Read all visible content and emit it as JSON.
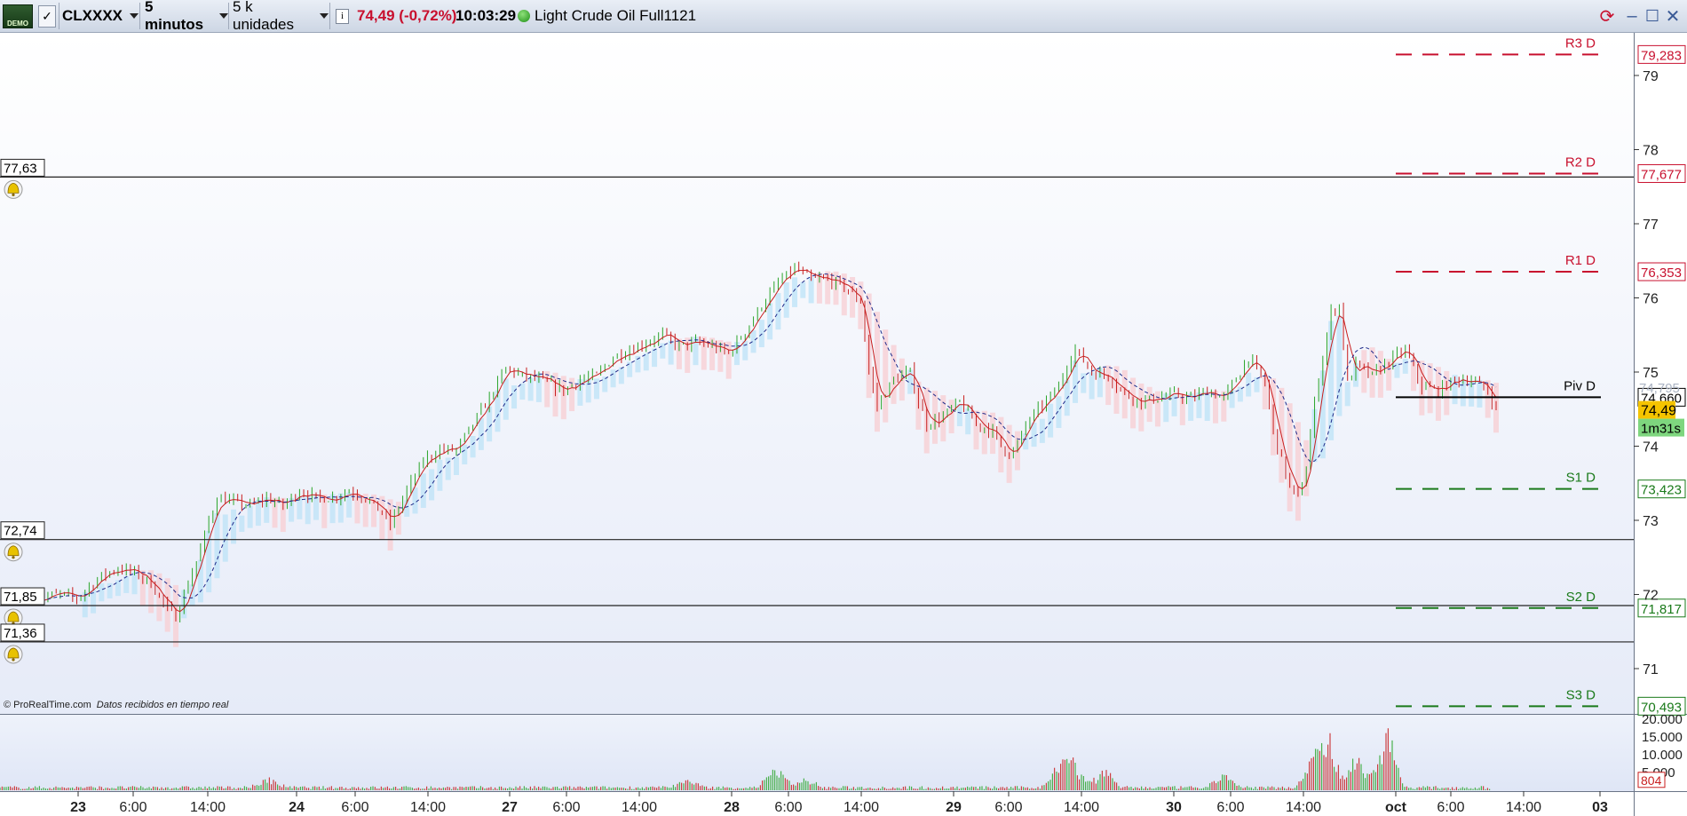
{
  "toolbar": {
    "demo_badge": "DEMO",
    "instrument": "CLXXXX",
    "timeframe": "5 minutos",
    "units": "5 k unidades",
    "price": "74,49",
    "change": "(-0,72%)",
    "time": "10:03:29",
    "instrument_name": "Light Crude Oil Full1121",
    "info_icon": "info-icon",
    "colors": {
      "price_text": "#c8102e",
      "status_dot": "#2ea32a"
    }
  },
  "window_controls": [
    "refresh-icon",
    "minimize-icon",
    "maximize-icon",
    "close-icon"
  ],
  "price_axis": {
    "ticks": [
      "79",
      "78",
      "77",
      "76",
      "75",
      "74",
      "73",
      "72",
      "71"
    ],
    "current_price": "74,49",
    "countdown": "1m31s",
    "partial_label": "74,795",
    "colors": {
      "resistance": "#c8102e",
      "support": "#1a7a1a",
      "pivot": "#000000",
      "current_bg": "#f5c400",
      "countdown_bg": "#7ed67e"
    }
  },
  "pivots": [
    {
      "label": "R3 D",
      "value": "79,283",
      "type": "resistance",
      "price": 79.283
    },
    {
      "label": "R2 D",
      "value": "77,677",
      "type": "resistance",
      "price": 77.677
    },
    {
      "label": "R1 D",
      "value": "76,353",
      "type": "resistance",
      "price": 76.353
    },
    {
      "label": "Piv D",
      "value": "74,660",
      "type": "pivot",
      "price": 74.66
    },
    {
      "label": "S1 D",
      "value": "73,423",
      "type": "support",
      "price": 73.423
    },
    {
      "label": "S2 D",
      "value": "71,817",
      "type": "support",
      "price": 71.817
    },
    {
      "label": "S3 D",
      "value": "70,493",
      "type": "support",
      "price": 70.493
    }
  ],
  "alert_lines": [
    {
      "label": "77,63",
      "price": 77.63
    },
    {
      "label": "72,74",
      "price": 72.74
    },
    {
      "label": "71,85",
      "price": 71.85
    },
    {
      "label": "71,36",
      "price": 71.36
    }
  ],
  "alert_icon": "bell-icon",
  "copyright": "© ProRealTime.com",
  "copyright_note": "Datos recibidos en tiempo real",
  "volume_axis": {
    "ticks": [
      "20.000",
      "15.000",
      "10.000",
      "5.000"
    ],
    "current": "804"
  },
  "time_axis": [
    {
      "label": "23",
      "bold": true
    },
    {
      "label": "6:00",
      "bold": false
    },
    {
      "label": "14:00",
      "bold": false
    },
    {
      "label": "24",
      "bold": true
    },
    {
      "label": "6:00",
      "bold": false
    },
    {
      "label": "14:00",
      "bold": false
    },
    {
      "label": "27",
      "bold": true
    },
    {
      "label": "6:00",
      "bold": false
    },
    {
      "label": "14:00",
      "bold": false
    },
    {
      "label": "28",
      "bold": true
    },
    {
      "label": "6:00",
      "bold": false
    },
    {
      "label": "14:00",
      "bold": false
    },
    {
      "label": "29",
      "bold": true
    },
    {
      "label": "6:00",
      "bold": false
    },
    {
      "label": "14:00",
      "bold": false
    },
    {
      "label": "30",
      "bold": true
    },
    {
      "label": "6:00",
      "bold": false
    },
    {
      "label": "14:00",
      "bold": false
    },
    {
      "label": "oct",
      "bold": true
    },
    {
      "label": "6:00",
      "bold": false
    },
    {
      "label": "14:00",
      "bold": false
    },
    {
      "label": "03",
      "bold": true
    }
  ],
  "price_path": [
    [
      0,
      71.95
    ],
    [
      3,
      72.0
    ],
    [
      5,
      71.95
    ],
    [
      8,
      72.25
    ],
    [
      10,
      72.35
    ],
    [
      12,
      72.3
    ],
    [
      14,
      72.15
    ],
    [
      16,
      71.8
    ],
    [
      17,
      71.7
    ],
    [
      18,
      72.0
    ],
    [
      20,
      72.6
    ],
    [
      21,
      73.0
    ],
    [
      22,
      73.3
    ],
    [
      24,
      73.25
    ],
    [
      26,
      73.2
    ],
    [
      28,
      73.3
    ],
    [
      30,
      73.2
    ],
    [
      32,
      73.4
    ],
    [
      34,
      73.3
    ],
    [
      36,
      73.3
    ],
    [
      38,
      73.4
    ],
    [
      40,
      73.3
    ],
    [
      42,
      73.1
    ],
    [
      43,
      72.95
    ],
    [
      45,
      73.4
    ],
    [
      47,
      73.8
    ],
    [
      49,
      73.95
    ],
    [
      51,
      73.95
    ],
    [
      53,
      74.3
    ],
    [
      55,
      74.65
    ],
    [
      57,
      75.05
    ],
    [
      59,
      74.95
    ],
    [
      61,
      74.9
    ],
    [
      63,
      74.8
    ],
    [
      64,
      74.75
    ],
    [
      66,
      74.9
    ],
    [
      68,
      74.95
    ],
    [
      70,
      75.2
    ],
    [
      72,
      75.3
    ],
    [
      74,
      75.4
    ],
    [
      76,
      75.5
    ],
    [
      78,
      75.35
    ],
    [
      80,
      75.4
    ],
    [
      82,
      75.35
    ],
    [
      84,
      75.25
    ],
    [
      86,
      75.55
    ],
    [
      88,
      75.9
    ],
    [
      90,
      76.2
    ],
    [
      92,
      76.4
    ],
    [
      94,
      76.25
    ],
    [
      96,
      76.25
    ],
    [
      98,
      76.15
    ],
    [
      100,
      75.95
    ],
    [
      101,
      75.0
    ],
    [
      102,
      74.55
    ],
    [
      104,
      74.9
    ],
    [
      106,
      75.0
    ],
    [
      107,
      74.6
    ],
    [
      108,
      74.3
    ],
    [
      110,
      74.4
    ],
    [
      112,
      74.6
    ],
    [
      114,
      74.3
    ],
    [
      116,
      74.2
    ],
    [
      117,
      74.0
    ],
    [
      118,
      73.9
    ],
    [
      119,
      74.0
    ],
    [
      120,
      74.3
    ],
    [
      122,
      74.55
    ],
    [
      124,
      74.8
    ],
    [
      125,
      75.1
    ],
    [
      126,
      75.3
    ],
    [
      128,
      75.0
    ],
    [
      130,
      74.95
    ],
    [
      132,
      74.7
    ],
    [
      134,
      74.6
    ],
    [
      136,
      74.65
    ],
    [
      138,
      74.7
    ],
    [
      140,
      74.65
    ],
    [
      142,
      74.75
    ],
    [
      144,
      74.65
    ],
    [
      146,
      75.0
    ],
    [
      147,
      75.2
    ],
    [
      149,
      74.85
    ],
    [
      150,
      74.2
    ],
    [
      151,
      73.8
    ],
    [
      152,
      73.45
    ],
    [
      153,
      73.3
    ],
    [
      154,
      73.7
    ],
    [
      155,
      74.6
    ],
    [
      156,
      75.2
    ],
    [
      157,
      75.8
    ],
    [
      158,
      75.9
    ],
    [
      159,
      74.85
    ],
    [
      160,
      75.1
    ],
    [
      162,
      74.95
    ],
    [
      164,
      75.15
    ],
    [
      166,
      75.3
    ],
    [
      168,
      74.8
    ],
    [
      170,
      74.75
    ],
    [
      172,
      74.9
    ],
    [
      174,
      74.9
    ],
    [
      176,
      74.75
    ],
    [
      177,
      74.5
    ]
  ],
  "volume_bars": {
    "count": 720,
    "spikes": [
      [
        0.18,
        3200
      ],
      [
        0.46,
        3000
      ],
      [
        0.52,
        7000
      ],
      [
        0.54,
        3500
      ],
      [
        0.71,
        8200
      ],
      [
        0.72,
        9000
      ],
      [
        0.74,
        6500
      ],
      [
        0.82,
        4200
      ],
      [
        0.88,
        9500
      ],
      [
        0.89,
        17500
      ],
      [
        0.91,
        12000
      ],
      [
        0.93,
        19000
      ]
    ]
  }
}
